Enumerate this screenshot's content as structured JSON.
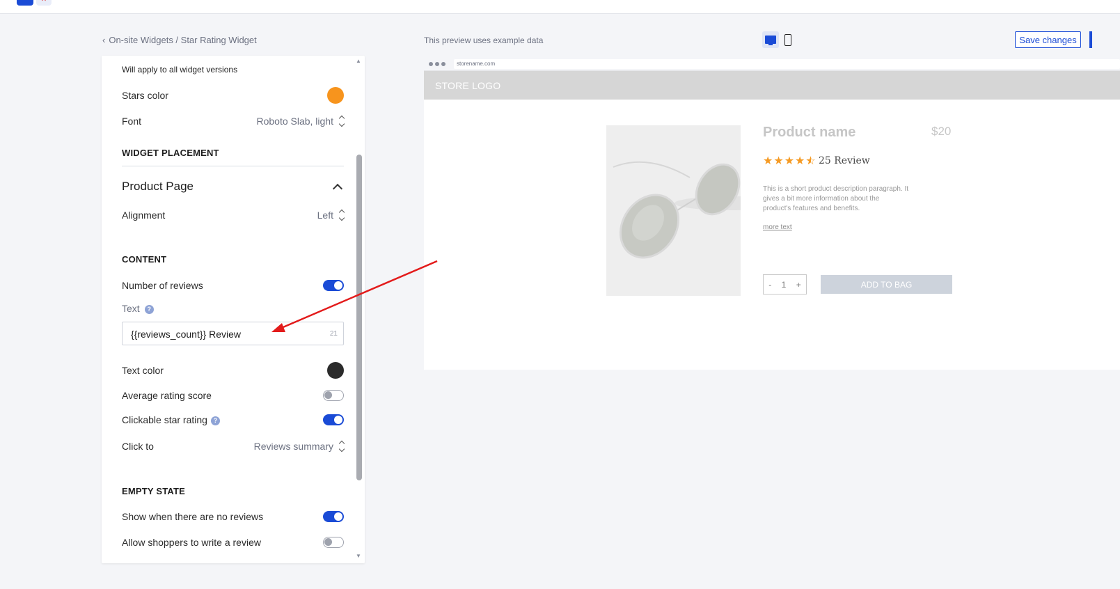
{
  "breadcrumb": {
    "text": "On-site Widgets / Star Rating Widget"
  },
  "panel": {
    "note": "Will apply to all widget versions",
    "stars_color": {
      "label": "Stars color",
      "color": "#f7941d"
    },
    "font": {
      "label": "Font",
      "value": "Roboto Slab, light"
    },
    "widget_placement": {
      "heading": "WIDGET PLACEMENT",
      "subheading": "Product Page"
    },
    "alignment": {
      "label": "Alignment",
      "value": "Left"
    },
    "content": {
      "heading": "CONTENT",
      "number_of_reviews": {
        "label": "Number of reviews",
        "on": true
      },
      "text": {
        "label": "Text",
        "value": "{{reviews_count}} Review",
        "count": "21"
      },
      "text_color": {
        "label": "Text color",
        "color": "#2b2b2b"
      },
      "average_rating": {
        "label": "Average rating score",
        "on": false
      },
      "clickable_star": {
        "label": "Clickable star rating",
        "on": true
      },
      "click_to": {
        "label": "Click to",
        "value": "Reviews summary"
      }
    },
    "empty_state": {
      "heading": "EMPTY STATE",
      "show_no_reviews": {
        "label": "Show when there are no reviews",
        "on": true
      },
      "allow_write": {
        "label": "Allow shoppers to write a review",
        "on": false
      }
    }
  },
  "preview": {
    "note": "This preview uses example data",
    "save_label": "Save changes",
    "url": "storename.com",
    "store_logo": "STORE LOGO",
    "product_name": "Product name",
    "price": "$20",
    "rating": 4.5,
    "review_text": "25 Review",
    "description": "This is a short product description paragraph. It gives a bit more information about the product's features and benefits.",
    "more_text": "more text",
    "qty_minus": "-",
    "qty_value": "1",
    "qty_plus": "+",
    "add_to_bag": "ADD TO BAG"
  },
  "colors": {
    "accent": "#1a4bd6",
    "annotation_arrow": "#e31b1b"
  }
}
